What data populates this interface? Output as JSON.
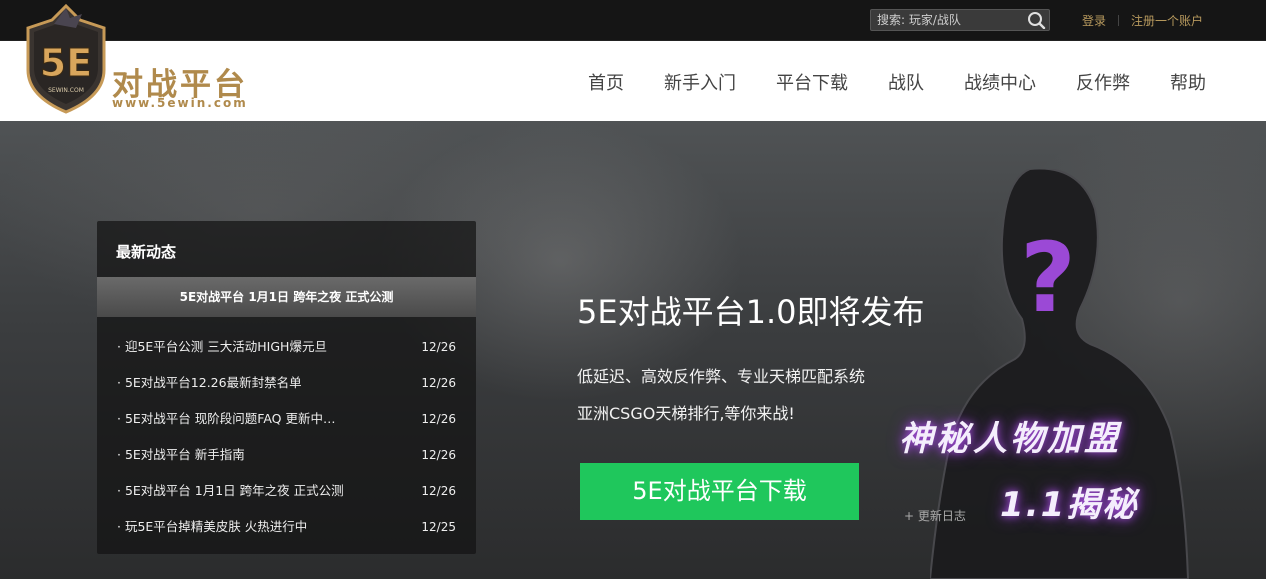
{
  "topbar": {
    "search_placeholder": "搜索: 玩家/战队",
    "login_label": "登录",
    "register_label": "注册一个账户"
  },
  "header": {
    "logo_badge": "5E",
    "logo_badge_small": "SEWIN.COM",
    "logo_title": "对战平台",
    "logo_url": "www.5ewin.com",
    "brand_color": "#b08a4c",
    "nav": [
      {
        "label": "首页"
      },
      {
        "label": "新手入门"
      },
      {
        "label": "平台下载"
      },
      {
        "label": "战队"
      },
      {
        "label": "战绩中心"
      },
      {
        "label": "反作弊"
      },
      {
        "label": "帮助"
      }
    ]
  },
  "news": {
    "title": "最新动态",
    "featured": "5E对战平台 1月1日 跨年之夜 正式公测",
    "items": [
      {
        "text": "迎5E平台公测 三大活动HIGH爆元旦",
        "date": "12/26"
      },
      {
        "text": "5E对战平台12.26最新封禁名单",
        "date": "12/26"
      },
      {
        "text": "5E对战平台 现阶段问题FAQ 更新中…",
        "date": "12/26"
      },
      {
        "text": "5E对战平台 新手指南",
        "date": "12/26"
      },
      {
        "text": "5E对战平台 1月1日 跨年之夜 正式公测",
        "date": "12/26"
      },
      {
        "text": "玩5E平台掉精美皮肤 火热进行中",
        "date": "12/25"
      }
    ]
  },
  "hero": {
    "title": "5E对战平台1.0即将发布",
    "desc_line1": "低延迟、高效反作弊、专业天梯匹配系统",
    "desc_line2": "亚洲CSGO天梯排行,等你来战!",
    "download_label": "5E对战平台下载",
    "download_color": "#1fc75c",
    "changelog_label": "+ 更新日志",
    "promo_line1": "神秘人物加盟",
    "promo_line2": "1.1揭秘",
    "mystery_mark": "?"
  }
}
